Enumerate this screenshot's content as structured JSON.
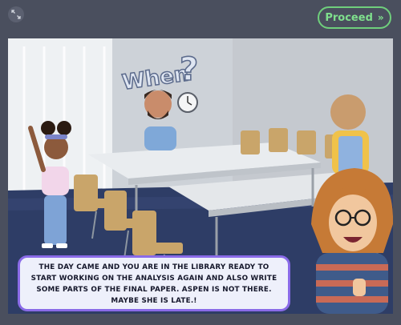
{
  "toolbar": {
    "expand_icon": "expand-arrows-icon",
    "proceed_label": "Proceed",
    "proceed_icon": "double-chevron-right-icon",
    "accent_color": "#6fcf7c"
  },
  "scene": {
    "thought_text": "When",
    "thought_mark": "?",
    "caption": "THE DAY CAME AND YOU ARE IN THE LIBRARY READY TO START WORKING ON THE ANALYSIS AGAIN AND ALSO WRITE SOME PARTS OF THE FINAL PAPER. ASPEN IS NOT THERE. MAYBE SHE IS LATE.!",
    "caption_border_color": "#8a6be8"
  }
}
